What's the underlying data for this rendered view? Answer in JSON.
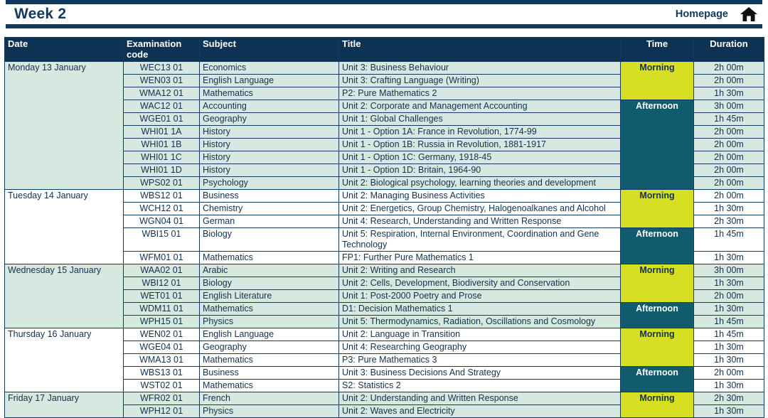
{
  "banner": {
    "title": "Week 2",
    "homepage_label": "Homepage",
    "home_icon": "home-icon"
  },
  "colors": {
    "navy": "#0E3254",
    "band_green": "#D6E8E0",
    "morning": "#D7DF23",
    "afternoon": "#105B6E",
    "title_navy": "#123A5F"
  },
  "table": {
    "columns": [
      "Date",
      "Examination code",
      "Subject",
      "Title",
      "Time",
      "Duration"
    ],
    "headers": {
      "date": "Date",
      "code_line1": "Examination",
      "code_line2": "code",
      "subject": "Subject",
      "title": "Title",
      "time": "Time",
      "duration": "Duration"
    },
    "days": [
      {
        "date": "Monday 13 January",
        "band": "green",
        "rows": [
          {
            "code": "WEC13 01",
            "subject": "Economics",
            "title": "Unit 3: Business Behaviour",
            "time": "Morning",
            "time_span": 3,
            "duration": "2h 00m"
          },
          {
            "code": "WEN03 01",
            "subject": "English Language",
            "title": "Unit 3: Crafting Language (Writing)",
            "time": "",
            "time_span": 0,
            "duration": "2h 00m"
          },
          {
            "code": "WMA12 01",
            "subject": "Mathematics",
            "title": "P2: Pure Mathematics 2",
            "time": "",
            "time_span": 0,
            "duration": "1h 30m"
          },
          {
            "code": "WAC12 01",
            "subject": "Accounting",
            "title": "Unit 2: Corporate and Management Accounting",
            "time": "Afternoon",
            "time_span": 7,
            "duration": "3h 00m"
          },
          {
            "code": "WGE01 01",
            "subject": "Geography",
            "title": "Unit 1: Global Challenges",
            "time": "",
            "time_span": 0,
            "duration": "1h 45m"
          },
          {
            "code": "WHI01 1A",
            "subject": "History",
            "title": "Unit 1 - Option 1A: France in Revolution, 1774-99",
            "time": "",
            "time_span": 0,
            "duration": "2h 00m"
          },
          {
            "code": "WHI01 1B",
            "subject": "History",
            "title": "Unit 1 - Option 1B: Russia in Revolution, 1881-1917",
            "time": "",
            "time_span": 0,
            "duration": "2h 00m"
          },
          {
            "code": "WHI01 1C",
            "subject": "History",
            "title": "Unit 1 - Option 1C: Germany, 1918-45",
            "time": "",
            "time_span": 0,
            "duration": "2h 00m"
          },
          {
            "code": "WHI01 1D",
            "subject": "History",
            "title": "Unit 1 - Option 1D: Britain, 1964-90",
            "time": "",
            "time_span": 0,
            "duration": "2h 00m"
          },
          {
            "code": "WPS02 01",
            "subject": "Psychology",
            "title": "Unit 2: Biological psychology, learning theories and development",
            "time": "",
            "time_span": 0,
            "duration": "2h 00m"
          }
        ]
      },
      {
        "date": "Tuesday 14 January",
        "band": "white",
        "rows": [
          {
            "code": "WBS12 01",
            "subject": "Business",
            "title": "Unit 2: Managing Business Activities",
            "time": "Morning",
            "time_span": 3,
            "duration": "2h 00m"
          },
          {
            "code": "WCH12 01",
            "subject": "Chemistry",
            "title": "Unit 2: Energetics, Group Chemistry, Halogenoalkanes and Alcohol",
            "time": "",
            "time_span": 0,
            "duration": "1h 30m"
          },
          {
            "code": "WGN04 01",
            "subject": "German",
            "title": "Unit 4: Research, Understanding and Written Response",
            "time": "",
            "time_span": 0,
            "duration": "2h 30m"
          },
          {
            "code": "WBI15 01",
            "subject": "Biology",
            "title": "Unit 5: Respiration, Internal Environment, Coordination and Gene Technology",
            "time": "Afternoon",
            "time_span": 2,
            "duration": "1h 45m",
            "tall": true
          },
          {
            "code": "WFM01 01",
            "subject": "Mathematics",
            "title": "FP1: Further Pure Mathematics 1",
            "time": "",
            "time_span": 0,
            "duration": "1h 30m"
          }
        ]
      },
      {
        "date": "Wednesday 15 January",
        "band": "green",
        "rows": [
          {
            "code": "WAA02 01",
            "subject": "Arabic",
            "title": "Unit 2: Writing and Research",
            "time": "Morning",
            "time_span": 3,
            "duration": "3h 00m"
          },
          {
            "code": "WBI12 01",
            "subject": "Biology",
            "title": "Unit 2: Cells, Development, Biodiversity and Conservation",
            "time": "",
            "time_span": 0,
            "duration": "1h 30m"
          },
          {
            "code": "WET01 01",
            "subject": "English Literature",
            "title": "Unit 1: Post-2000 Poetry and Prose",
            "time": "",
            "time_span": 0,
            "duration": "2h 00m"
          },
          {
            "code": "WDM11 01",
            "subject": "Mathematics",
            "title": "D1: Decision Mathematics 1",
            "time": "Afternoon",
            "time_span": 2,
            "duration": "1h 30m"
          },
          {
            "code": "WPH15 01",
            "subject": "Physics",
            "title": "Unit 5: Thermodynamics, Radiation, Oscillations and Cosmology",
            "time": "",
            "time_span": 0,
            "duration": "1h 45m"
          }
        ]
      },
      {
        "date": "Thursday 16 January",
        "band": "white",
        "rows": [
          {
            "code": "WEN02 01",
            "subject": "English Language",
            "title": "Unit 2: Language in Transition",
            "time": "Morning",
            "time_span": 3,
            "duration": "1h 45m"
          },
          {
            "code": "WGE04 01",
            "subject": "Geography",
            "title": "Unit 4: Researching Geography",
            "time": "",
            "time_span": 0,
            "duration": "1h 30m"
          },
          {
            "code": "WMA13 01",
            "subject": "Mathematics",
            "title": "P3: Pure Mathematics 3",
            "time": "",
            "time_span": 0,
            "duration": "1h 30m"
          },
          {
            "code": "WBS13 01",
            "subject": "Business",
            "title": "Unit 3: Business Decisions And Strategy",
            "time": "Afternoon",
            "time_span": 2,
            "duration": "2h 00m"
          },
          {
            "code": "WST02 01",
            "subject": "Mathematics",
            "title": "S2: Statistics 2",
            "time": "",
            "time_span": 0,
            "duration": "1h 30m"
          }
        ]
      },
      {
        "date": "Friday 17 January",
        "band": "green",
        "rows": [
          {
            "code": "WFR02 01",
            "subject": "French",
            "title": "Unit 2: Understanding and Written Response",
            "time": "Morning",
            "time_span": 2,
            "duration": "2h 30m"
          },
          {
            "code": "WPH12 01",
            "subject": "Physics",
            "title": "Unit 2: Waves and Electricity",
            "time": "",
            "time_span": 0,
            "duration": "1h 30m"
          }
        ]
      }
    ]
  }
}
